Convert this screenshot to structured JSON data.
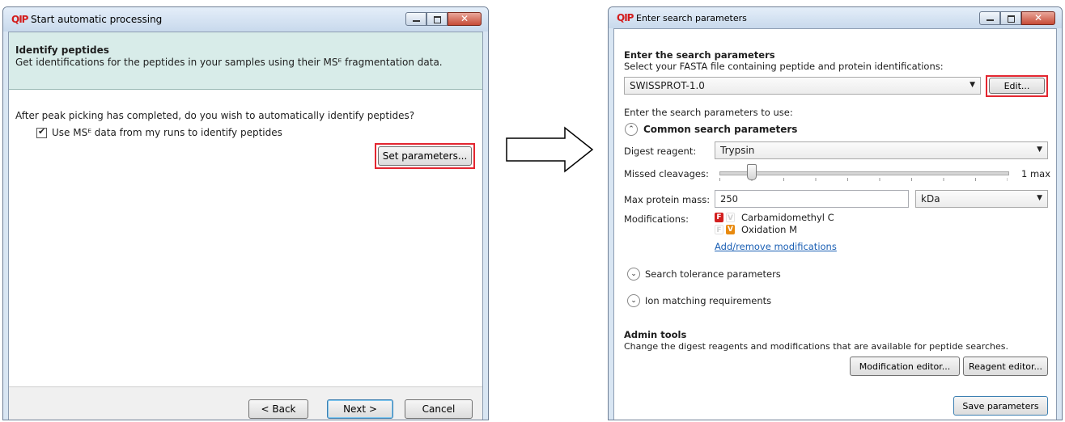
{
  "arrow_label": "",
  "left_window": {
    "logo": "QIP",
    "title": "Start automatic processing",
    "header_title": "Identify peptides",
    "header_desc": "Get identifications for the peptides in your samples using their MSᴱ fragmentation data.",
    "question": "After peak picking has completed, do you wish to automatically identify peptides?",
    "checkbox_label": "Use MSᴱ data from my runs to identify peptides",
    "checkbox_checked": true,
    "set_params_label": "Set parameters...",
    "back_label": "< Back",
    "next_label": "Next >",
    "cancel_label": "Cancel"
  },
  "right_window": {
    "logo": "QIP",
    "title": "Enter search parameters",
    "section_title": "Enter the search parameters",
    "fasta_prompt": "Select your FASTA file containing peptide and protein identifications:",
    "fasta_value": "SWISSPROT-1.0",
    "edit_label": "Edit...",
    "params_prompt": "Enter the search parameters to use:",
    "common_title": "Common search parameters",
    "digest_label": "Digest reagent:",
    "digest_value": "Trypsin",
    "missed_label": "Missed cleavages:",
    "missed_value": 1,
    "missed_value_text": "1 max",
    "mass_label": "Max protein mass:",
    "mass_value": "250",
    "mass_unit": "kDa",
    "mods_label": "Modifications:",
    "mods": [
      {
        "on": "F",
        "off": "V",
        "name": "Carbamidomethyl C",
        "color": "#d21f1f"
      },
      {
        "off": "F",
        "on": "V",
        "name": "Oxidation M",
        "color": "#e88a10"
      }
    ],
    "add_remove_label": "Add/remove modifications",
    "tolerance_title": "Search tolerance parameters",
    "ion_title": "Ion matching requirements",
    "admin_title": "Admin tools",
    "admin_desc": "Change the digest reagents and modifications that are available for peptide searches.",
    "mod_editor_label": "Modification editor...",
    "reagent_editor_label": "Reagent editor...",
    "save_label": "Save parameters"
  }
}
